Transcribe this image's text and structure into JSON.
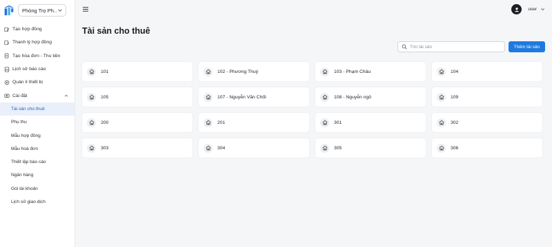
{
  "app": {
    "property_selector": "Phòng Trọ Ph..."
  },
  "nav": {
    "items": [
      {
        "label": "Tạo hợp đồng",
        "icon": "contract-edit-icon"
      },
      {
        "label": "Thanh lý hợp đồng",
        "icon": "contract-end-icon"
      },
      {
        "label": "Tạo hóa đơn - Thu tiền",
        "icon": "invoice-icon"
      },
      {
        "label": "Lịch sử báo cáo",
        "icon": "report-history-icon"
      },
      {
        "label": "Quản lí thiết bị",
        "icon": "device-icon"
      }
    ],
    "settings": {
      "label": "Cài đặt",
      "icon": "settings-icon",
      "items": [
        {
          "label": "Tài sản cho thuê",
          "active": true
        },
        {
          "label": "Phụ thu"
        },
        {
          "label": "Mẫu hợp đồng"
        },
        {
          "label": "Mẫu hoá đơn"
        },
        {
          "label": "Thiết lập báo cáo"
        },
        {
          "label": "Ngân hàng"
        },
        {
          "label": "Gói tài khoản"
        },
        {
          "label": "Lịch sử giao dịch"
        }
      ]
    }
  },
  "header": {
    "username": "user"
  },
  "page": {
    "title": "Tài sản cho thuê",
    "search_placeholder": "Tìm tài sản",
    "add_label": "Thêm tài sản"
  },
  "properties": [
    "101",
    "102 - Phương Thuý",
    "103 - Phạm Châu",
    "104",
    "105",
    "107 - Nguyễn Văn Chối",
    "108 - Nguyễn ngô",
    "109",
    "200",
    "201",
    "301",
    "302",
    "303",
    "304",
    "305",
    "306"
  ],
  "colors": {
    "accent": "#1f7ae0",
    "active_bg": "#e9f0fb",
    "active_text": "#1f5fc4",
    "page_bg": "#f5f6f8"
  }
}
